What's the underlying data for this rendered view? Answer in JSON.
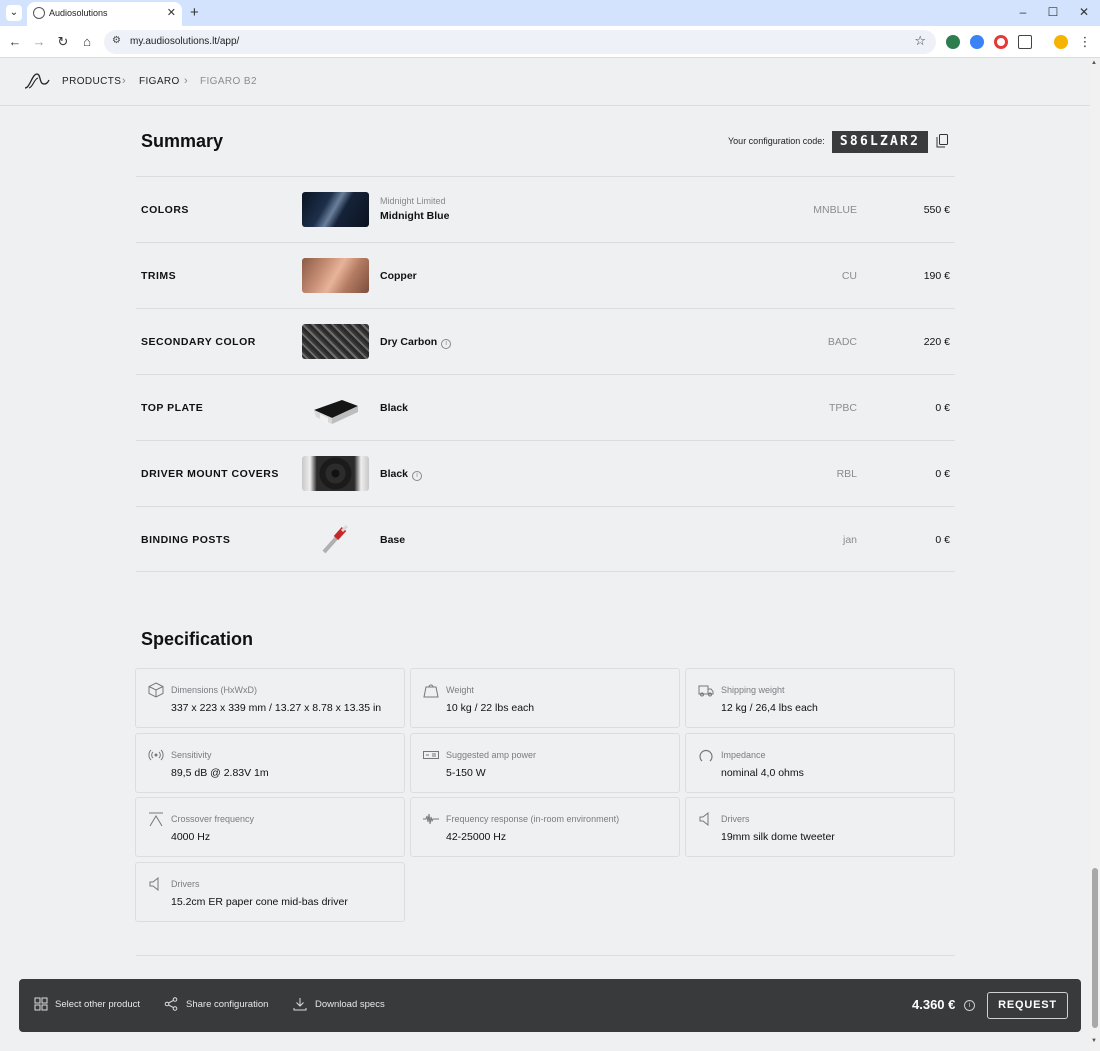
{
  "browser": {
    "tab_title": "Audiosolutions",
    "url": "my.audiosolutions.lt/app/"
  },
  "breadcrumb": {
    "items": [
      "PRODUCTS",
      "FIGARO",
      "FIGARO B2"
    ]
  },
  "summary": {
    "title": "Summary",
    "config_label": "Your configuration code:",
    "config_code": "S86LZAR2",
    "rows": [
      {
        "label": "COLORS",
        "sub": "Midnight Limited",
        "name": "Midnight Blue",
        "code": "MNBLUE",
        "price": "550 €"
      },
      {
        "label": "TRIMS",
        "sub": "",
        "name": "Copper",
        "code": "CU",
        "price": "190 €"
      },
      {
        "label": "SECONDARY COLOR",
        "sub": "",
        "name": "Dry Carbon",
        "code": "BADC",
        "price": "220 €"
      },
      {
        "label": "TOP PLATE",
        "sub": "",
        "name": "Black",
        "code": "TPBC",
        "price": "0 €"
      },
      {
        "label": "DRIVER MOUNT COVERS",
        "sub": "",
        "name": "Black",
        "code": "RBL",
        "price": "0 €"
      },
      {
        "label": "BINDING POSTS",
        "sub": "",
        "name": "Base",
        "code": "jan",
        "price": "0 €"
      }
    ]
  },
  "specification": {
    "title": "Specification",
    "items": [
      {
        "label": "Dimensions (HxWxD)",
        "value": "337 x 223 x 339 mm / 13.27 x 8.78 x 13.35 in",
        "icon": "box-icon"
      },
      {
        "label": "Weight",
        "value": "10 kg / 22 lbs each",
        "icon": "weight-icon"
      },
      {
        "label": "Shipping weight",
        "value": "12 kg / 26,4 lbs each",
        "icon": "truck-icon"
      },
      {
        "label": "Sensitivity",
        "value": "89,5 dB @ 2.83V 1m",
        "icon": "signal-icon"
      },
      {
        "label": "Suggested amp power",
        "value": "5-150 W",
        "icon": "amplifier-icon"
      },
      {
        "label": "Impedance",
        "value": "nominal 4,0 ohms",
        "icon": "impedance-icon"
      },
      {
        "label": "Crossover frequency",
        "value": "4000 Hz",
        "icon": "crossover-icon"
      },
      {
        "label": "Frequency response (in-room environment)",
        "value": "42-25000 Hz",
        "icon": "waveform-icon"
      },
      {
        "label": "Drivers",
        "value": "19mm silk dome tweeter",
        "icon": "speaker-icon"
      },
      {
        "label": "Drivers",
        "value": "15.2cm ER paper cone mid-bas driver",
        "icon": "speaker-icon"
      }
    ]
  },
  "bottom_bar": {
    "select_other": "Select other product",
    "share": "Share configuration",
    "download": "Download specs",
    "total": "4.360 €",
    "request": "REQUEST"
  }
}
